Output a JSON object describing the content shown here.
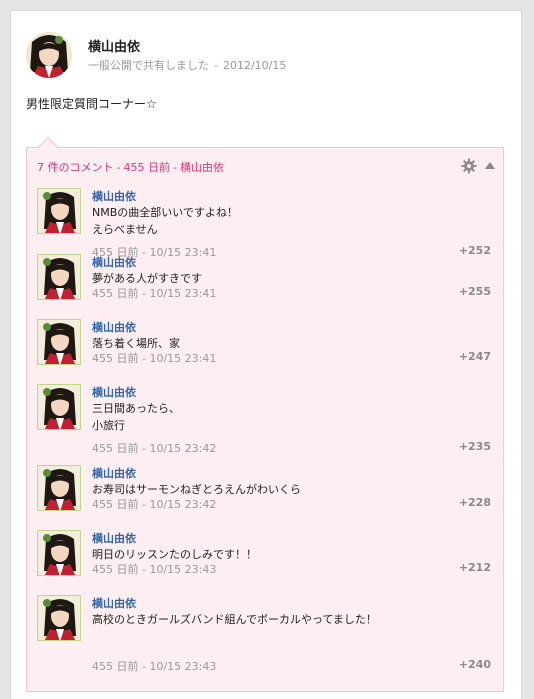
{
  "post": {
    "author": "横山由依",
    "visibility": "一般公開で共有しました",
    "separator": "-",
    "date": "2012/10/15",
    "text": "男性限定質問コーナー☆"
  },
  "comments_header": {
    "count": "7 件のコメント",
    "age": "455 日前",
    "author": "横山由依",
    "dash": "-"
  },
  "comments": [
    {
      "name": "横山由依",
      "lines": [
        "NMBの曲全部いいですよね！",
        "えらべません"
      ],
      "time": "455 日前 - 10/15 23:41",
      "plus": "+252"
    },
    {
      "name": "横山由依",
      "lines": [
        "夢がある人がすきです"
      ],
      "time": "455 日前 - 10/15 23:41",
      "plus": "+255"
    },
    {
      "name": "横山由依",
      "lines": [
        "落ち着く場所、家"
      ],
      "time": "455 日前 - 10/15 23:41",
      "plus": "+247"
    },
    {
      "name": "横山由依",
      "lines": [
        "三日間あったら、",
        "小旅行"
      ],
      "time": "455 日前 - 10/15 23:42",
      "plus": "+235"
    },
    {
      "name": "横山由依",
      "lines": [
        "お寿司はサーモンねぎとろえんがわいくら"
      ],
      "time": "455 日前 - 10/15 23:42",
      "plus": "+228"
    },
    {
      "name": "横山由依",
      "lines": [
        "明日のリッスンたのしみです！！"
      ],
      "time": "455 日前 - 10/15 23:43",
      "plus": "+212"
    },
    {
      "name": "横山由依",
      "lines": [
        "高校のときガールズバンド組んでボーカルやってました！"
      ],
      "time": "455 日前 - 10/15 23:43",
      "plus": "+240"
    }
  ]
}
